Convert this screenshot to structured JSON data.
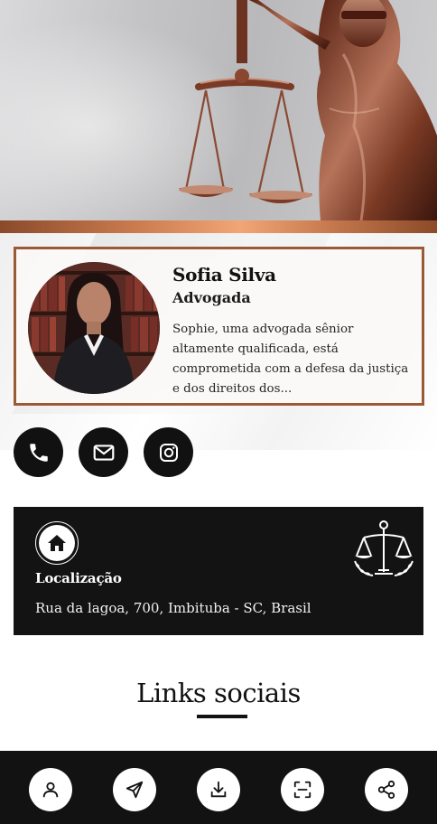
{
  "hero": {
    "image": "lady-justice-statue-with-scales"
  },
  "profile": {
    "name": "Sofia Silva",
    "role": "Advogada",
    "bio": "Sophie, uma advogada sênior altamente qualificada, está comprometida com a defesa da justiça e dos direitos dos...",
    "photo": "lawyer-portrait-in-library"
  },
  "contact": {
    "buttons": [
      {
        "icon": "phone-icon"
      },
      {
        "icon": "mail-icon"
      },
      {
        "icon": "instagram-icon"
      }
    ]
  },
  "location": {
    "title": "Localização",
    "address": "Rua da lagoa, 700, Imbituba - SC, Brasil",
    "icon": "home-icon",
    "emblem": "law-scales-emblem"
  },
  "social": {
    "title": "Links sociais"
  },
  "bottom_bar": {
    "buttons": [
      {
        "icon": "user-icon"
      },
      {
        "icon": "send-icon"
      },
      {
        "icon": "download-icon"
      },
      {
        "icon": "scan-icon"
      },
      {
        "icon": "share-icon"
      }
    ]
  },
  "colors": {
    "accent_copper": "#9b5a37",
    "dark": "#131313",
    "white": "#ffffff"
  }
}
